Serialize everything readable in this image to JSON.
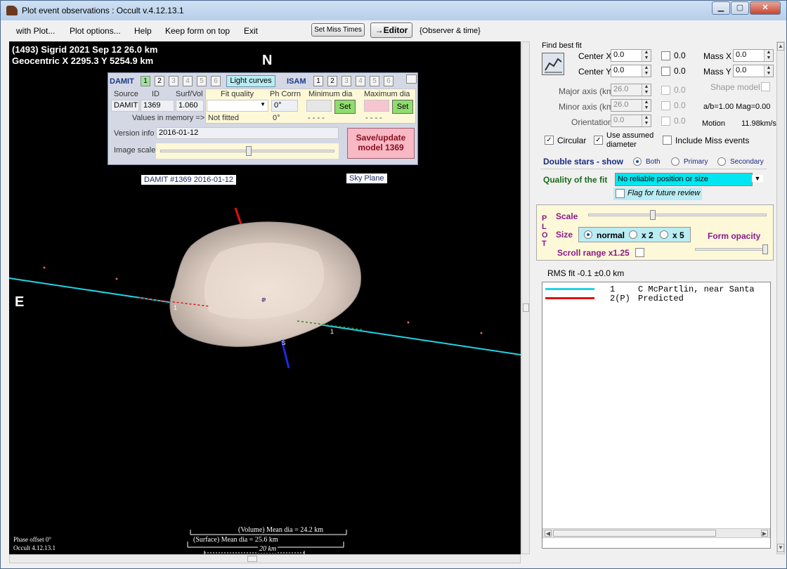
{
  "window": {
    "title": "Plot event observations : Occult v.4.12.13.1"
  },
  "menu": {
    "with_plot": "with Plot...",
    "plot_options": "Plot options...",
    "help": "Help",
    "keep_on_top": "Keep form on top",
    "exit": "Exit",
    "set_miss_times": "Set Miss Times",
    "editor": "→Editor",
    "observer_time": "{Observer & time}"
  },
  "plot": {
    "header_line1": "(1493) Sigrid  2021 Sep 12   26.0 km",
    "header_line2": "Geocentric  X  2295.3  Y 5254.9 km",
    "north": "N",
    "east": "E",
    "damit_label": "DAMIT #1369 2016-01-12",
    "sky_plane": "Sky Plane",
    "phase_offset": "Phase offset 0°",
    "occult_version": "Occult 4.12.13.1",
    "vol_dia": "(Volume) Mean dia = 24.2 km",
    "surf_dia": "(Surface) Mean dia = 25.6 km",
    "scale_km": "20 km",
    "chord_label1": "1",
    "chord_label2": "1",
    "pole_p": "P",
    "pole_s": "S"
  },
  "damit": {
    "title": "DAMIT",
    "numbers": [
      "1",
      "2",
      "3",
      "4",
      "5",
      "6"
    ],
    "light_curves": "Light curves",
    "isam": "ISAM",
    "isam_numbers": [
      "1",
      "2",
      "3",
      "4",
      "5",
      "6"
    ],
    "source_h": "Source",
    "id_h": "ID",
    "surfvol_h": "Surf/Vol",
    "source": "DAMIT",
    "id": "1369",
    "surfvol": "1.060",
    "fit_quality_h": "Fit quality",
    "ph_corrn_h": "Ph Corrn",
    "min_dia_h": "Minimum dia",
    "max_dia_h": "Maximum dia",
    "ph_corrn": "0°",
    "set": "Set",
    "values_in_memory": "Values in memory =>",
    "not_fitted": "Not fitted",
    "mem_ph": "0°",
    "dash1": "- - - -",
    "dash2": "- - - -",
    "version_info_h": "Version info",
    "version_info": "2016-01-12",
    "image_scale_h": "Image scale",
    "save_update": "Save/update",
    "model": "model  1369"
  },
  "right": {
    "find_best_fit": "Find best fit",
    "center_x": "Center X",
    "center_x_v": "0.0",
    "cx_chk": "0.0",
    "center_y": "Center Y",
    "center_y_v": "0.0",
    "cy_chk": "0.0",
    "mass_x": "Mass X",
    "mass_x_v": "0.0",
    "mass_y": "Mass Y",
    "mass_y_v": "0.0",
    "major_axis": "Major axis (km)",
    "major_v": "26.0",
    "major_chk": "0.0",
    "minor_axis": "Minor axis (km)",
    "minor_v": "26.0",
    "minor_chk": "0.0",
    "orientation": "Orientation",
    "orient_v": "0.0",
    "orient_chk": "0.0",
    "shape_model": "Shape model",
    "ab_mag": "a/b=1.00  Mag=0.00",
    "motion": "Motion",
    "motion_v": "11.98km/s",
    "circular": "Circular",
    "use_assumed": "Use assumed",
    "diameter": "diameter",
    "include_miss": "Include Miss events",
    "double_stars": "Double stars - show",
    "both": "Both",
    "primary": "Primary",
    "secondary": "Secondary",
    "quality_fit": "Quality of the fit",
    "quality_value": "No reliable position or size",
    "flag_review": "Flag for future review",
    "plot_letters": [
      "P",
      "L",
      "O",
      "T"
    ],
    "scale": "Scale",
    "size": "Size",
    "normal": "normal",
    "x2": "x 2",
    "x5": "x 5",
    "form_opacity": "Form opacity",
    "scroll_range": "Scroll range x1.25",
    "rms_fit": "RMS fit -0.1 ±0.0 km"
  },
  "legend": {
    "rows": [
      {
        "num": "1",
        "text": "C McPartlin, near Santa",
        "color": "#22d3e6"
      },
      {
        "num": "2(P)",
        "text": "Predicted",
        "color": "#e01010"
      }
    ]
  }
}
